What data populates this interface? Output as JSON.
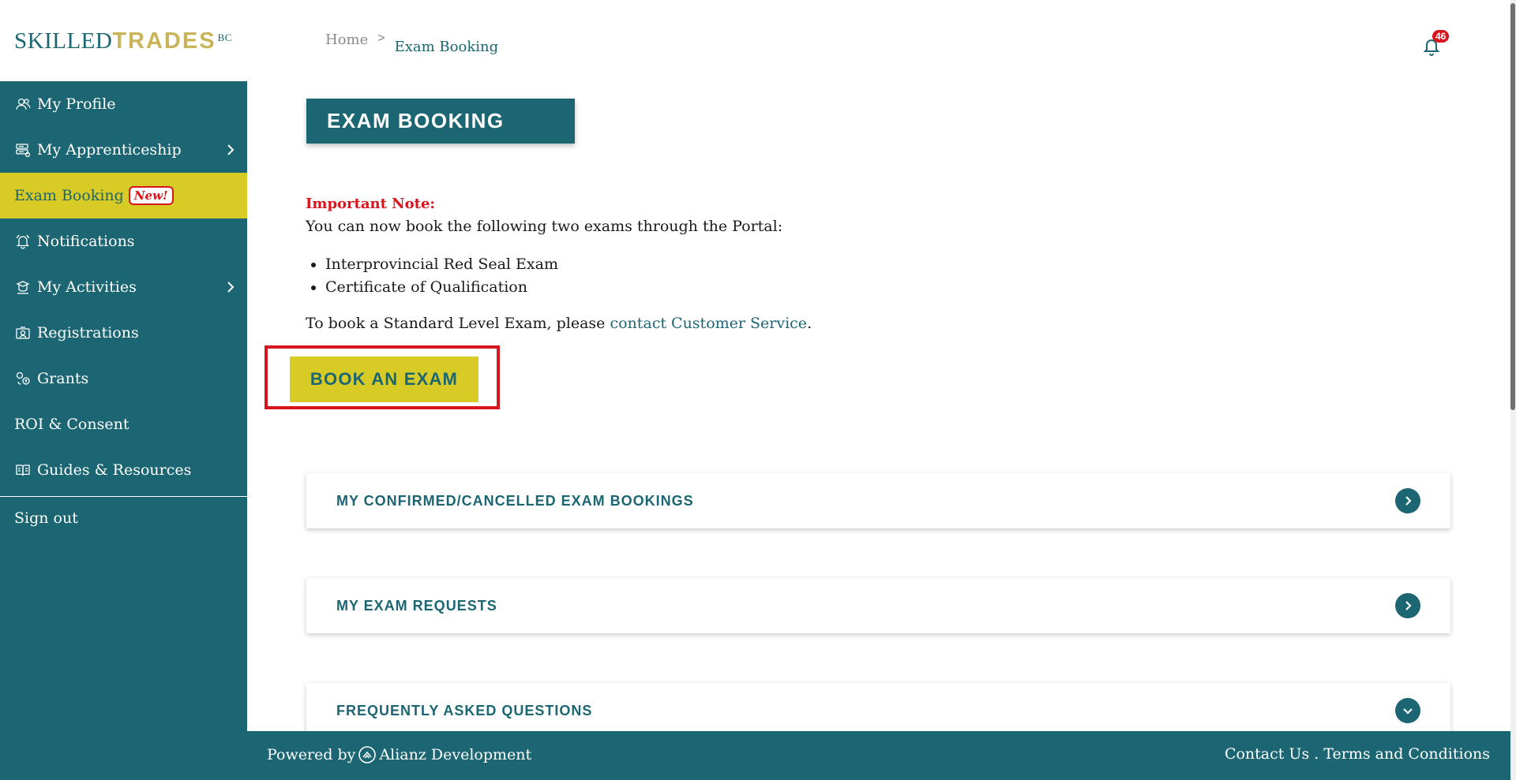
{
  "brand": {
    "skilled": "SKILLED",
    "trades": "TRADES",
    "bc": "BC"
  },
  "sidebar": {
    "items": [
      {
        "label": "My Profile",
        "icon": "profile-icon"
      },
      {
        "label": "My Apprenticeship",
        "icon": "apprenticeship-icon",
        "has_submenu": true
      },
      {
        "label": "Exam Booking",
        "icon": "",
        "badge": "New!",
        "active": true
      },
      {
        "label": "Notifications",
        "icon": "bell-icon"
      },
      {
        "label": "My Activities",
        "icon": "activities-icon",
        "has_submenu": true
      },
      {
        "label": "Registrations",
        "icon": "registrations-icon"
      },
      {
        "label": "Grants",
        "icon": "grants-icon"
      },
      {
        "label": "ROI & Consent",
        "icon": ""
      },
      {
        "label": "Guides & Resources",
        "icon": "guides-icon"
      }
    ],
    "sign_out": "Sign out"
  },
  "breadcrumb": {
    "home": "Home",
    "separator": ">",
    "current": "Exam Booking"
  },
  "notifications": {
    "count": "46"
  },
  "main": {
    "title": "EXAM BOOKING",
    "important_label": "Important Note:",
    "intro": "You can now book the following two exams through the Portal:",
    "exams": [
      "Interprovincial Red Seal Exam",
      "Certificate of Qualification"
    ],
    "standard_prefix": "To book a Standard Level Exam, please ",
    "standard_link": "contact Customer Service",
    "standard_suffix": ".",
    "book_button": "BOOK AN EXAM",
    "accordions": [
      {
        "label": "MY CONFIRMED/CANCELLED EXAM BOOKINGS",
        "state": "collapsed"
      },
      {
        "label": "MY EXAM REQUESTS",
        "state": "collapsed"
      },
      {
        "label": "FREQUENTLY ASKED QUESTIONS",
        "state": "expanded"
      }
    ]
  },
  "footer": {
    "powered_by": "Powered by",
    "company": "Alianz Development",
    "links": "Contact Us . Terms and Conditions"
  },
  "colors": {
    "primary": "#1b6672",
    "accent": "#d9cb26",
    "alert": "#d8141c",
    "logo_gold": "#c9b45a"
  }
}
